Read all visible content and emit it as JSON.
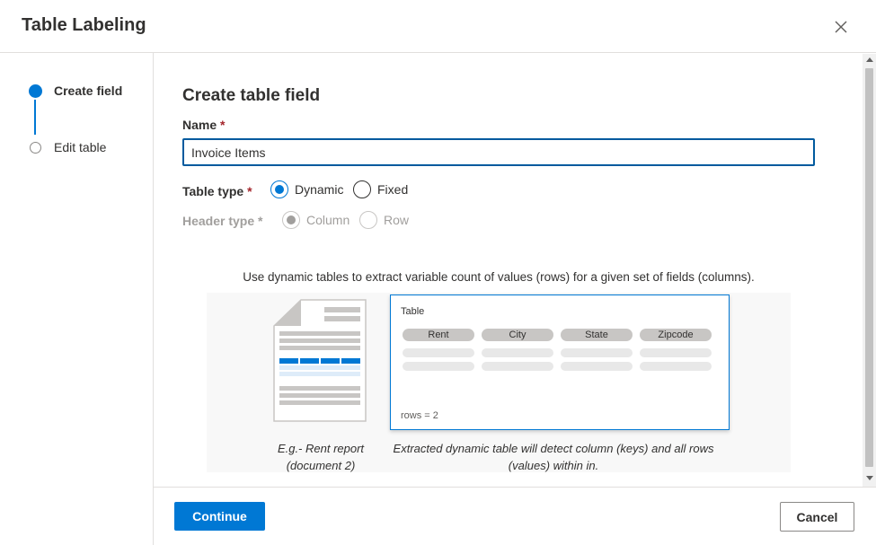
{
  "dialog": {
    "title": "Table Labeling",
    "close_icon": "close-icon"
  },
  "steps": [
    {
      "label": "Create field",
      "state": "active"
    },
    {
      "label": "Edit table",
      "state": "pending"
    }
  ],
  "form": {
    "title": "Create table field",
    "name_label": "Name",
    "required_mark": "*",
    "name_value": "Invoice Items",
    "table_type_label": "Table type",
    "table_type_options": [
      "Dynamic",
      "Fixed"
    ],
    "table_type_selected": "Dynamic",
    "header_type_label": "Header type",
    "header_type_options": [
      "Column",
      "Row"
    ],
    "header_type_selected": "Column",
    "header_type_disabled": true
  },
  "illustration": {
    "description": "Use dynamic tables to extract variable count of values (rows) for a given set of fields (columns).",
    "table_title": "Table",
    "columns": [
      "Rent",
      "City",
      "State",
      "Zipcode"
    ],
    "rows_text": "rows = 2",
    "caption_doc": "E.g.- Rent report (document 2)",
    "caption_table": "Extracted dynamic table will detect column (keys) and all rows (values) within in."
  },
  "footer": {
    "continue_label": "Continue",
    "cancel_label": "Cancel"
  },
  "colors": {
    "accent": "#0078d4",
    "required": "#a4262c",
    "border": "#e1dfdd"
  }
}
